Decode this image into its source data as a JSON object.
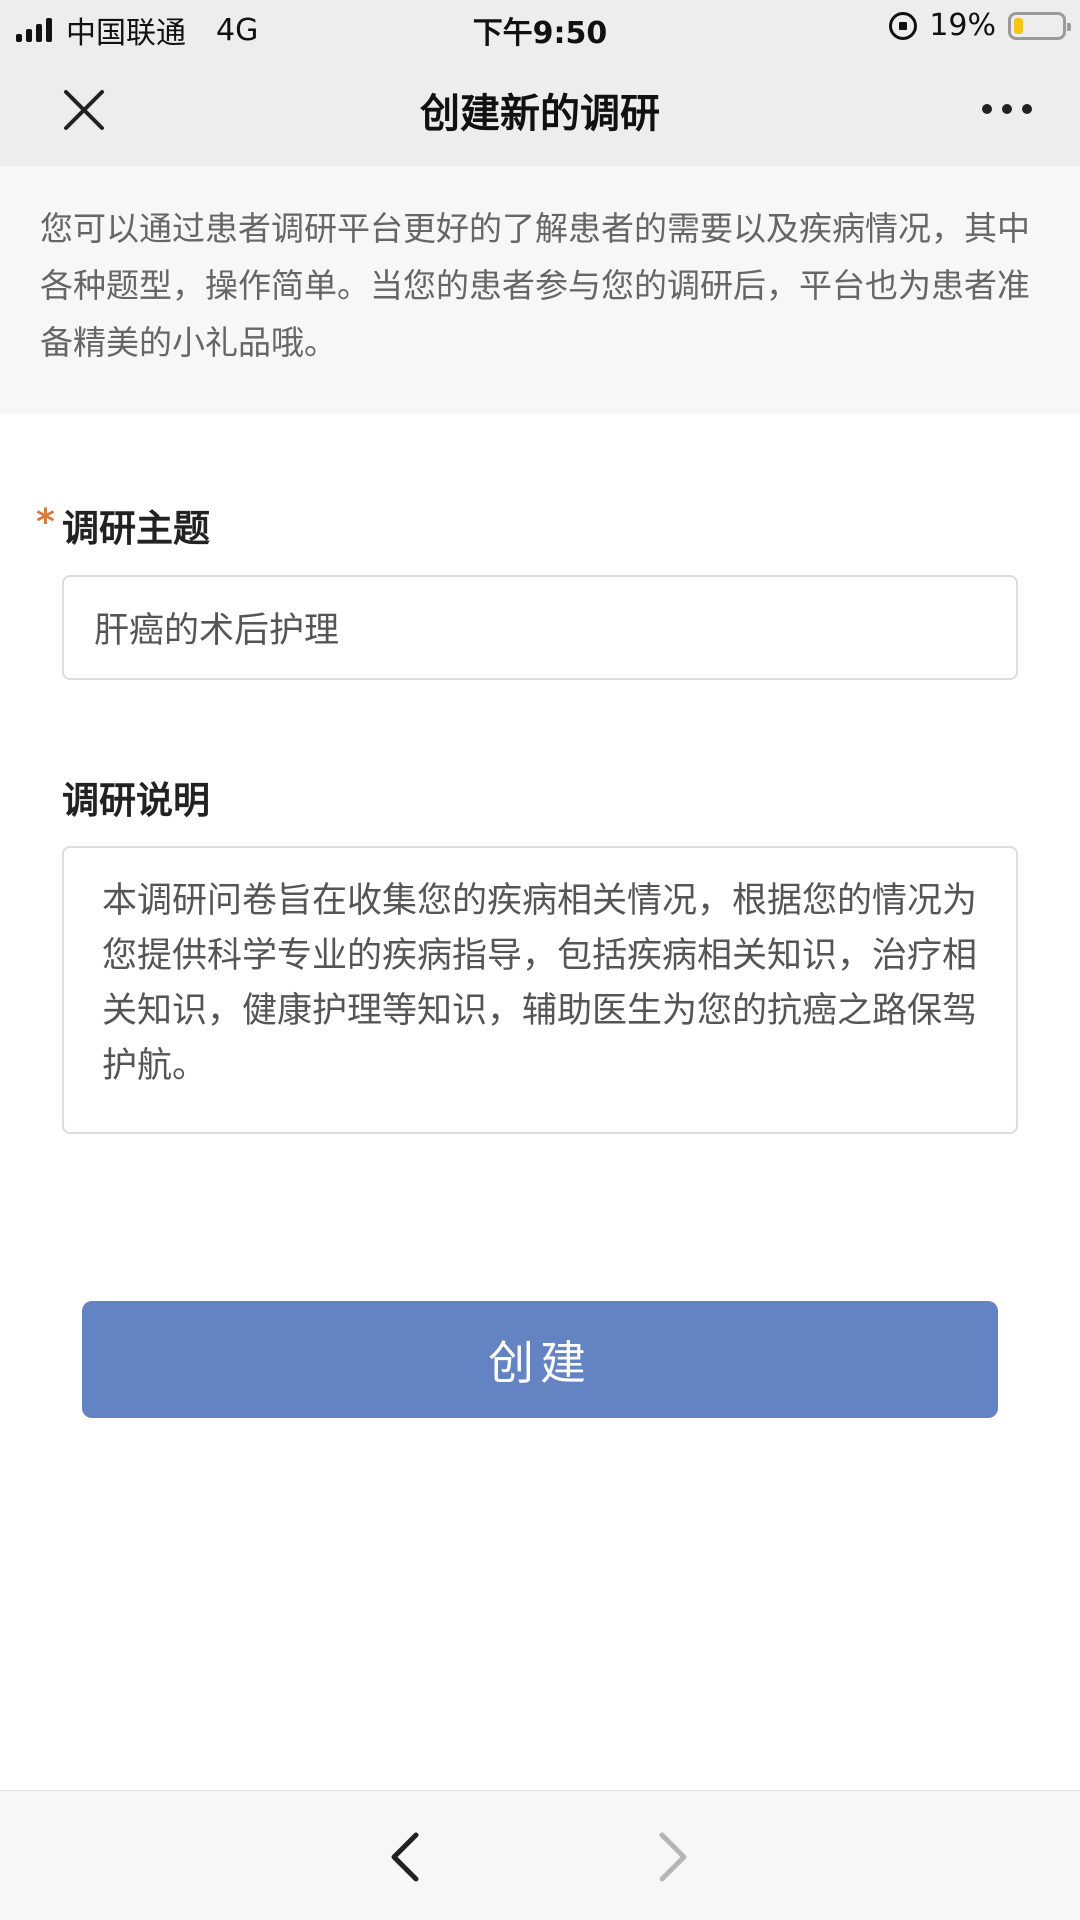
{
  "status_bar": {
    "carrier": "中国联通",
    "network": "4G",
    "time": "下午9:50",
    "battery_percent_label": "19%",
    "battery_level": 0.19,
    "icons": [
      "signal-icon",
      "rotation-lock-icon",
      "battery-icon"
    ]
  },
  "nav": {
    "title": "创建新的调研",
    "close_icon": "close-icon",
    "more_icon": "more-icon"
  },
  "intro": {
    "text": "您可以通过患者调研平台更好的了解患者的需要以及疾病情况，其中各种题型，操作简单。当您的患者参与您的调研后，平台也为患者准备精美的小礼品哦。"
  },
  "form": {
    "topic": {
      "required_mark": "*",
      "label": "调研主题",
      "value": "肝癌的术后护理"
    },
    "description": {
      "label": "调研说明",
      "value": "本调研问卷旨在收集您的疾病相关情况，根据您的情况为您提供科学专业的疾病指导，包括疾病相关知识，治疗相关知识，健康护理等知识，辅助医生为您的抗癌之路保驾护航。"
    },
    "submit_label": "创建"
  },
  "bottom_bar": {
    "back_icon": "back-arrow-icon",
    "forward_icon": "forward-arrow-icon"
  },
  "colors": {
    "accent": "#6383c3",
    "required": "#d97a3a",
    "battery": "#f5c518"
  }
}
